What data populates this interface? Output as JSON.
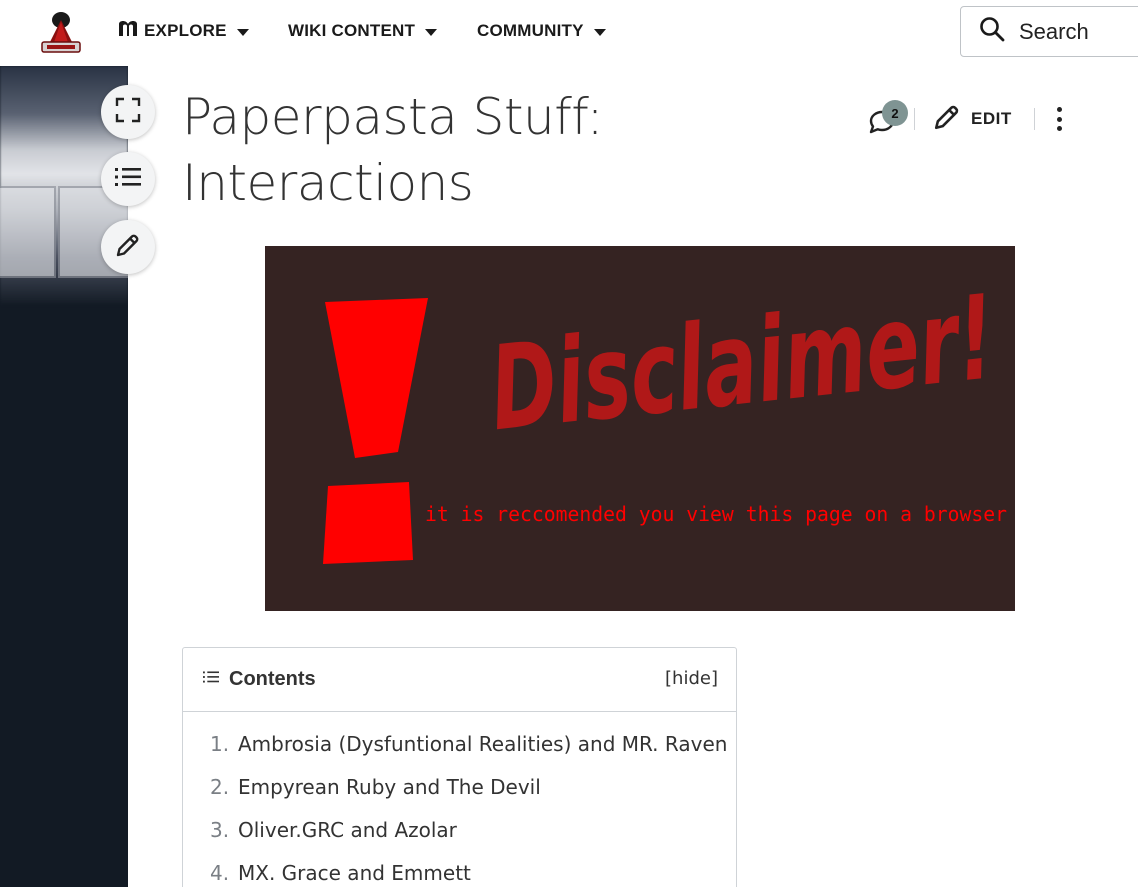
{
  "nav": {
    "items": [
      {
        "label": "EXPLORE",
        "icon": "book-icon"
      },
      {
        "label": "WIKI CONTENT"
      },
      {
        "label": "COMMUNITY"
      }
    ],
    "search_label": "Search"
  },
  "page": {
    "title_line1": "Paperpasta Stuff:",
    "title_line2": "Interactions",
    "comment_count": "2",
    "edit_label": "EDIT"
  },
  "disclaimer": {
    "heading": "Disclaimer!",
    "subtext": "it is reccomended you view this page on a browser",
    "heading_color": "#b01818",
    "accent_color": "#ff0000",
    "background_color": "#352322"
  },
  "toc": {
    "title": "Contents",
    "hide_label": "hide",
    "items": [
      {
        "num": "1.",
        "text": "Ambrosia (Dysfuntional Realities) and MR. Raven"
      },
      {
        "num": "2.",
        "text": "Empyrean Ruby and The Devil"
      },
      {
        "num": "3.",
        "text": "Oliver.GRC and Azolar"
      },
      {
        "num": "4.",
        "text": "MX. Grace and Emmett"
      }
    ]
  },
  "colors": {
    "rail": "#121a24",
    "badge": "#7f9493"
  }
}
